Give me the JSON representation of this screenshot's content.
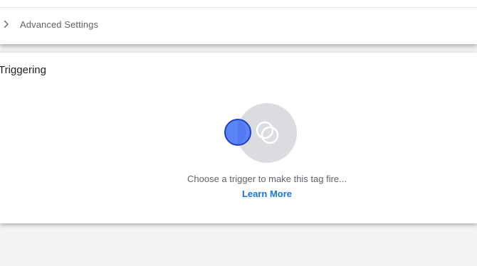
{
  "advanced_settings": {
    "label": "Advanced Settings",
    "expanded": false,
    "chevron_icon": "chevron-right-icon"
  },
  "triggering": {
    "title": "Triggering",
    "empty_message": "Choose a trigger to make this tag fire...",
    "learn_more_label": "Learn More",
    "graphic_icon": "trigger-placeholder-icon"
  },
  "colors": {
    "accent_blue": "#5b84f5",
    "accent_blue_border": "#1f3ec9",
    "link_blue": "#1a73e8",
    "gray_circle": "#dadce0",
    "background": "#f1f3f4"
  }
}
